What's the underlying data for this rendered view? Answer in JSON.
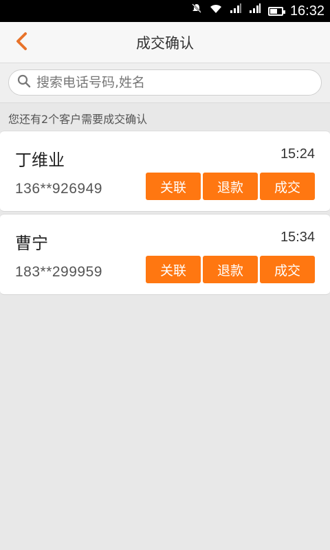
{
  "status_bar": {
    "time": "16:32",
    "battery_level": 0.6,
    "icons": [
      "notification-off-icon",
      "wifi-icon",
      "signal-icon",
      "signal-icon",
      "battery-icon"
    ]
  },
  "header": {
    "title": "成交确认",
    "back_icon": "chevron-left-icon"
  },
  "search": {
    "placeholder": "搜索电话号码,姓名",
    "value": ""
  },
  "hint_text": "您还有2个客户需要成交确认",
  "customers": [
    {
      "name": "丁维业",
      "phone": "136**926949",
      "time": "15:24",
      "actions": [
        "关联",
        "退款",
        "成交"
      ]
    },
    {
      "name": "曹宁",
      "phone": "183**299959",
      "time": "15:34",
      "actions": [
        "关联",
        "退款",
        "成交"
      ]
    }
  ],
  "colors": {
    "accent": "#ff7711",
    "back_icon": "#e8732a",
    "background": "#e8e8e8"
  }
}
